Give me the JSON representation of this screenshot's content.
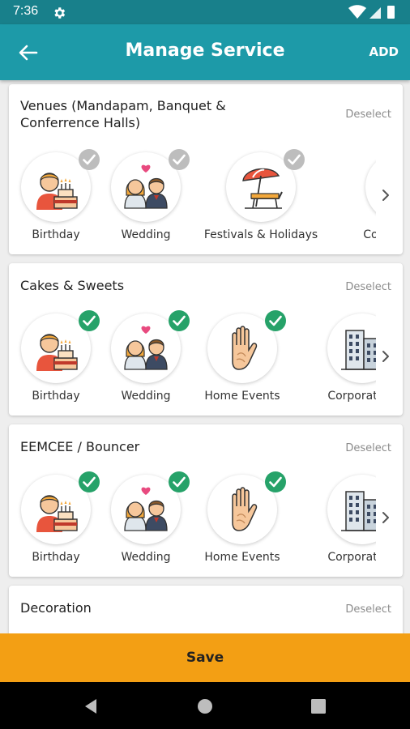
{
  "status_bar": {
    "time": "7:36"
  },
  "app_bar": {
    "title": "Manage Service",
    "add_label": "ADD"
  },
  "sections": [
    {
      "title": "Venues (Mandapam, Banquet  & Conferrence Halls)",
      "deselect": "Deselect",
      "items": [
        {
          "label": "Birthday",
          "icon": "birthday-icon",
          "selected": false
        },
        {
          "label": "Wedding",
          "icon": "wedding-icon",
          "selected": false
        },
        {
          "label": "Festivals & Holidays",
          "icon": "beach-umbrella-icon",
          "selected": false
        },
        {
          "label": "Corpo",
          "icon": "corporate-icon",
          "selected": false
        }
      ]
    },
    {
      "title": "Cakes & Sweets",
      "deselect": "Deselect",
      "items": [
        {
          "label": "Birthday",
          "icon": "birthday-icon",
          "selected": true
        },
        {
          "label": "Wedding",
          "icon": "wedding-icon",
          "selected": true
        },
        {
          "label": "Home Events",
          "icon": "hand-icon",
          "selected": true
        },
        {
          "label": "Corporate &",
          "icon": "building-icon",
          "selected": true
        }
      ]
    },
    {
      "title": "EEMCEE / Bouncer",
      "deselect": "Deselect",
      "items": [
        {
          "label": "Birthday",
          "icon": "birthday-icon",
          "selected": true
        },
        {
          "label": "Wedding",
          "icon": "wedding-icon",
          "selected": true
        },
        {
          "label": "Home Events",
          "icon": "hand-icon",
          "selected": true
        },
        {
          "label": "Corporate &",
          "icon": "building-icon",
          "selected": true
        }
      ]
    },
    {
      "title": "Decoration",
      "deselect": "Deselect",
      "items": []
    }
  ],
  "save_label": "Save",
  "colors": {
    "app_bar": "#1d9aa8",
    "status_bar": "#18808b",
    "check_selected": "#26a269",
    "check_unselected": "#bdbdbd",
    "save_button": "#f39f14"
  }
}
